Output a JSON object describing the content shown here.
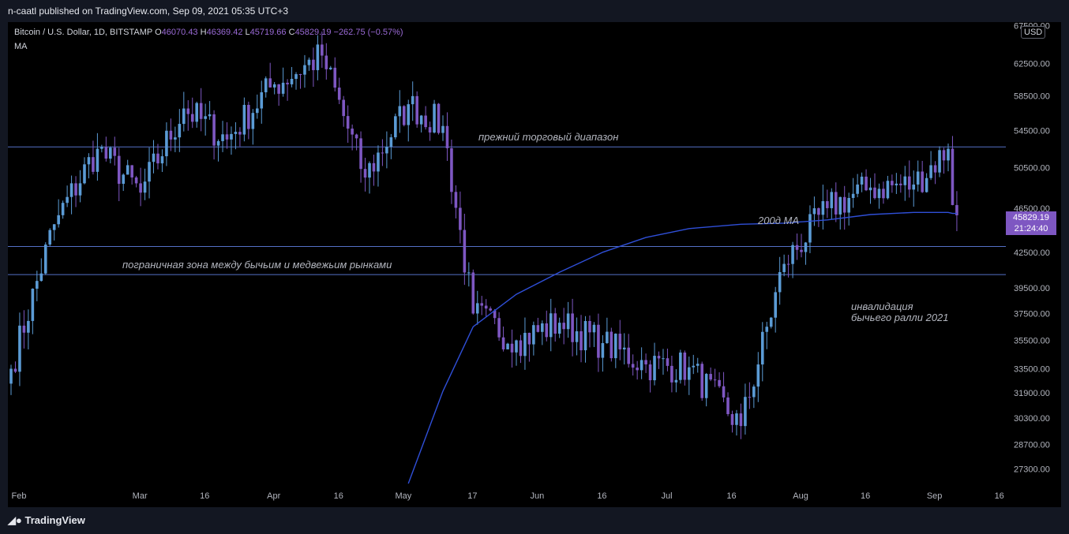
{
  "header": {
    "publisher_line": "n-caatl published on TradingView.com, Sep 09, 2021 05:35 UTC+3"
  },
  "legend": {
    "symbol": "Bitcoin / U.S. Dollar, 1D, BITSTAMP",
    "O_label": "O",
    "O": "46070.43",
    "H_label": "H",
    "H": "46369.42",
    "L_label": "L",
    "L": "45719.66",
    "C_label": "C",
    "C": "45829.19",
    "change": "−262.75 (−0.57%)",
    "indicator": "MA"
  },
  "price_axis": {
    "currency": "USD",
    "ticks": [
      "67500.00",
      "62500.00",
      "58500.00",
      "54500.00",
      "50500.00",
      "46500.00",
      "42500.00",
      "39500.00",
      "37500.00",
      "35500.00",
      "33500.00",
      "31900.00",
      "30300.00",
      "28700.00",
      "27300.00"
    ],
    "current_price": "45829.19",
    "countdown": "21:24:40"
  },
  "time_axis": {
    "ticks": [
      "Feb",
      "Mar",
      "16",
      "Apr",
      "16",
      "May",
      "17",
      "Jun",
      "16",
      "Jul",
      "16",
      "Aug",
      "16",
      "Sep",
      "16"
    ]
  },
  "annotations": {
    "prev_range": "прежний торговый диапазон",
    "ma200": "200д MA",
    "border_zone": "пограничная зона между бычьим и медвежьим рынками",
    "invalidation_1": "инвалидация",
    "invalidation_2": "бычьего ралли 2021"
  },
  "footer": {
    "brand": "TradingView"
  },
  "colors": {
    "background": "#000000",
    "up_candle": "#5b9bd5",
    "down_candle": "#7e57c2",
    "ma_line": "#2f4fd8",
    "level_line": "#5470c6",
    "price_tag": "#7e57c2"
  },
  "chart_data": {
    "type": "candlestick",
    "symbol": "BTCUSD",
    "interval": "1D",
    "scale": "log",
    "ylim": [
      26500,
      68000
    ],
    "x": [
      "2021-02-01",
      "2021-02-11",
      "2021-02-21",
      "2021-03-03",
      "2021-03-13",
      "2021-03-23",
      "2021-04-02",
      "2021-04-14",
      "2021-04-24",
      "2021-05-04",
      "2021-05-12",
      "2021-05-19",
      "2021-05-29",
      "2021-06-08",
      "2021-06-18",
      "2021-06-28",
      "2021-07-08",
      "2021-07-20",
      "2021-07-30",
      "2021-08-09",
      "2021-08-19",
      "2021-08-29",
      "2021-09-06",
      "2021-09-07",
      "2021-09-08"
    ],
    "series": [
      {
        "values": [
          33500,
          45000,
          52500,
          48000,
          57000,
          53500,
          59500,
          63500,
          49500,
          57500,
          55000,
          37500,
          35500,
          36800,
          35300,
          33800,
          33600,
          29800,
          41500,
          46500,
          48500,
          48800,
          52500,
          46800,
          45829.19
        ]
      },
      {
        "values": [
          null,
          null,
          null,
          null,
          null,
          null,
          null,
          null,
          null,
          26500,
          32000,
          36500,
          39000,
          40800,
          42500,
          43800,
          44600,
          45000,
          45100,
          45400,
          45900,
          46100,
          46100,
          46000,
          46000
        ]
      }
    ],
    "levels": [
      52700,
      43000,
      40600
    ]
  }
}
